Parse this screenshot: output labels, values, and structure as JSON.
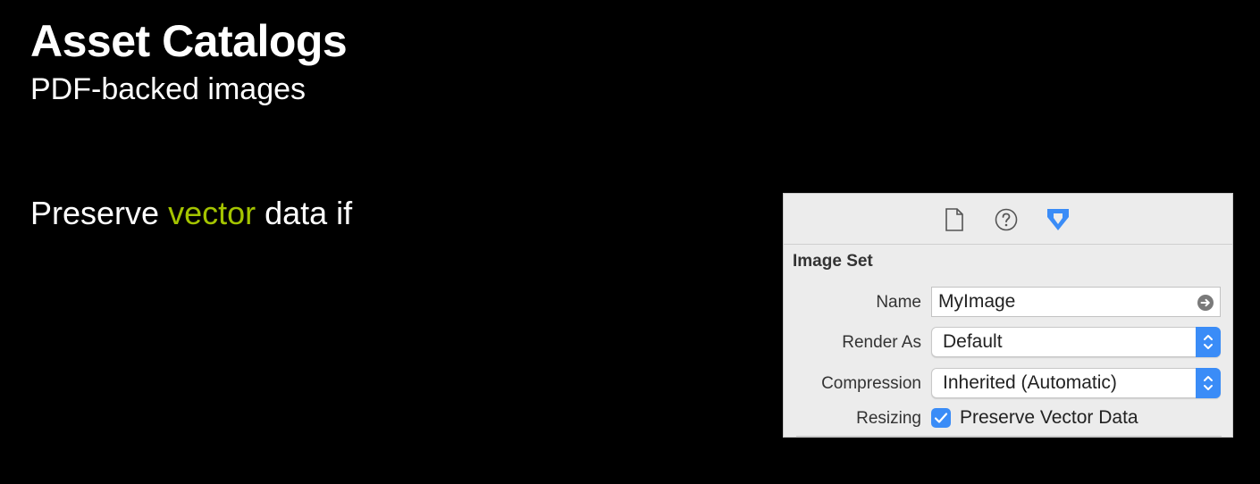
{
  "slide": {
    "title": "Asset Catalogs",
    "subtitle": "PDF-backed images",
    "body_before": "Preserve ",
    "body_highlight": "vector",
    "body_after": " data if",
    "highlight_color": "#a4c400"
  },
  "inspector": {
    "toolbar_icons": [
      "file-inspector-icon",
      "help-inspector-icon",
      "attributes-inspector-icon"
    ],
    "active_tab_color": "#3a8cf7",
    "section_title": "Image Set",
    "name": {
      "label": "Name",
      "value": "MyImage",
      "action_icon": "go-arrow-icon"
    },
    "render_as": {
      "label": "Render As",
      "value": "Default"
    },
    "compression": {
      "label": "Compression",
      "value": "Inherited (Automatic)"
    },
    "resizing": {
      "label": "Resizing",
      "checkbox_label": "Preserve Vector Data",
      "checked": true
    }
  }
}
